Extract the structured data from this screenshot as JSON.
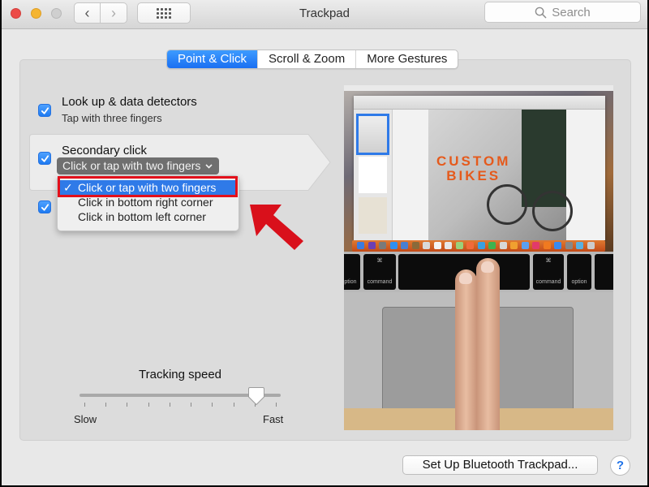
{
  "window": {
    "title": "Trackpad",
    "search_placeholder": "Search",
    "nav": {
      "back": "‹",
      "forward": "›"
    }
  },
  "tabs": [
    {
      "label": "Point & Click",
      "active": true
    },
    {
      "label": "Scroll & Zoom",
      "active": false
    },
    {
      "label": "More Gestures",
      "active": false
    }
  ],
  "options": [
    {
      "title": "Look up & data detectors",
      "subtitle": "Tap with three fingers",
      "checked": true
    },
    {
      "title": "Secondary click",
      "selected_value": "Click or tap with two fingers",
      "checked": true
    },
    {
      "title": "",
      "checked": true
    }
  ],
  "secondary_click_menu": {
    "items": [
      {
        "label": "Click or tap with two fingers",
        "selected": true
      },
      {
        "label": "Click in bottom right corner",
        "selected": false
      },
      {
        "label": "Click in bottom left corner",
        "selected": false
      }
    ],
    "check_glyph": "✓",
    "chevron_glyph": "⌄"
  },
  "tracking_speed": {
    "label": "Tracking speed",
    "min_label": "Slow",
    "max_label": "Fast",
    "tick_count": 10,
    "value_fraction": 0.9
  },
  "preview": {
    "headline_line1": "CUSTOM",
    "headline_line2": "BIKES",
    "keys": [
      "option",
      "command",
      "command",
      "option"
    ]
  },
  "annotation": {
    "highlight_color": "#e3101b"
  },
  "footer": {
    "setup_button": "Set Up Bluetooth Trackpad...",
    "help_button": "?"
  }
}
